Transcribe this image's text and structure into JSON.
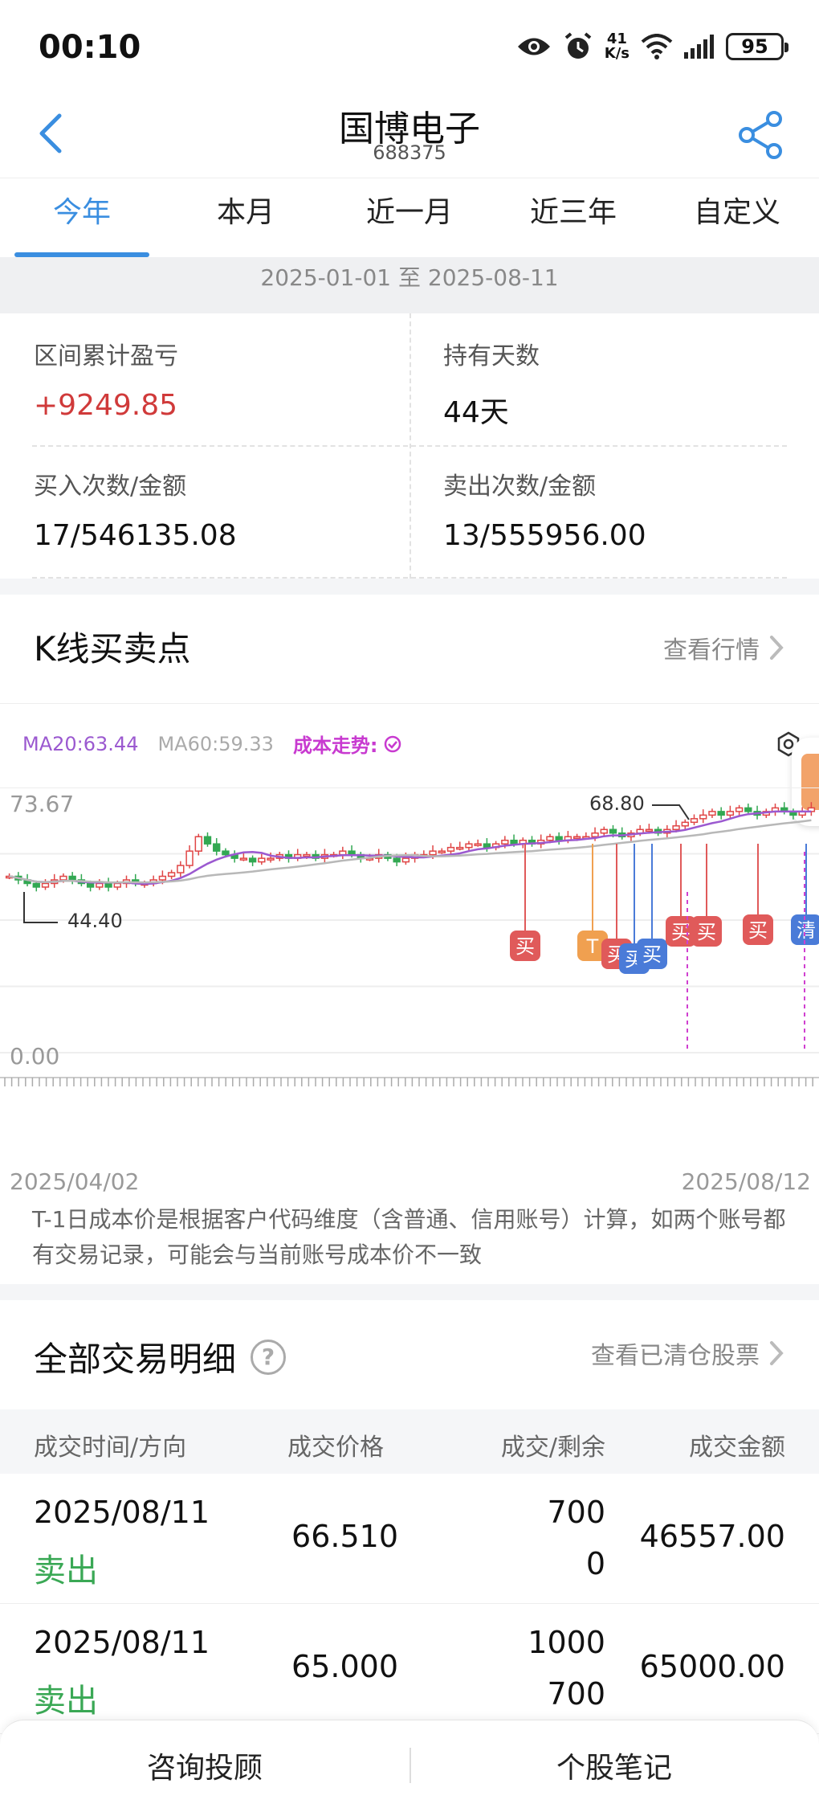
{
  "status_bar": {
    "time": "00:10",
    "net_speed_value": "41",
    "net_speed_unit": "K/s",
    "battery": "95",
    "icons": [
      "eye-icon",
      "alarm-icon",
      "wifi-icon",
      "signal-icon",
      "battery-icon"
    ]
  },
  "header": {
    "title": "国博电子",
    "code": "688375",
    "back_icon": "chevron-left-icon",
    "share_icon": "share-icon",
    "accent_color": "#3a8ee0"
  },
  "tabs": [
    {
      "label": "今年",
      "active": true
    },
    {
      "label": "本月",
      "active": false
    },
    {
      "label": "近一月",
      "active": false
    },
    {
      "label": "近三年",
      "active": false
    },
    {
      "label": "自定义",
      "active": false
    }
  ],
  "date_range": "2025-01-01 至 2025-08-11",
  "summary": {
    "pnl_label": "区间累计盈亏",
    "pnl_value": "+9249.85",
    "hold_label": "持有天数",
    "hold_value": "44天",
    "buy_label": "买入次数/金额",
    "buy_value": "17/546135.08",
    "sell_label": "卖出次数/金额",
    "sell_value": "13/555956.00"
  },
  "kline": {
    "title": "K线买卖点",
    "link": "查看行情",
    "ma20": "MA20:63.44",
    "ma60": "MA60:59.33",
    "cost_trend": "成本走势:",
    "max_label": "73.67",
    "zero_label": "0.00",
    "high_marker": "68.80",
    "low_marker": "44.40",
    "start_date": "2025/04/02",
    "end_date": "2025/08/12",
    "marker_labels": [
      "买",
      "T",
      "买",
      "买",
      "买",
      "买",
      "买",
      "买",
      "清"
    ],
    "disclaimer": "T-1日成本价是根据客户代码维度（含普通、信用账号）计算，如两个账号都有交易记录，可能会与当前账号成本价不一致"
  },
  "chart_data": {
    "type": "candlestick",
    "x_range": [
      "2025/04/02",
      "2025/08/12"
    ],
    "ylim": [
      0,
      73.67
    ],
    "y_labels": [
      "73.67",
      "0.00"
    ],
    "annotations": [
      {
        "label": "68.80",
        "kind": "period-high"
      },
      {
        "label": "44.40",
        "kind": "period-low"
      }
    ],
    "series": [
      {
        "name": "MA20",
        "latest": 63.44
      },
      {
        "name": "MA60",
        "latest": 59.33
      }
    ],
    "close_series": [
      49,
      48,
      47,
      46,
      47,
      48,
      49,
      48,
      47,
      46,
      47,
      46,
      47,
      48,
      47,
      47,
      48,
      49,
      50,
      52,
      56,
      60,
      58,
      56,
      55,
      54,
      54,
      53,
      54,
      54,
      55,
      54,
      55,
      55,
      54,
      55,
      55,
      56,
      55,
      54,
      54,
      55,
      54,
      53,
      54,
      55,
      55,
      56,
      56,
      57,
      57,
      58,
      58,
      57,
      58,
      59,
      58,
      59,
      58,
      59,
      60,
      59,
      60,
      60,
      60,
      61,
      62,
      61,
      60,
      61,
      62,
      62,
      61,
      62,
      63,
      64,
      65,
      66,
      67,
      66,
      67,
      68,
      67,
      66,
      67,
      68,
      67,
      66,
      67,
      68
    ],
    "markers": [
      {
        "label": "买",
        "color": "#e05a5a"
      },
      {
        "label": "T",
        "color": "#f0a050"
      },
      {
        "label": "买",
        "color": "#e05a5a"
      },
      {
        "label": "买",
        "color": "#4a7bd8"
      },
      {
        "label": "买",
        "color": "#4a7bd8"
      },
      {
        "label": "买",
        "color": "#e05a5a"
      },
      {
        "label": "买",
        "color": "#e05a5a"
      },
      {
        "label": "买",
        "color": "#e05a5a"
      },
      {
        "label": "清",
        "color": "#4a7bd8"
      }
    ],
    "up_color": "#e04646",
    "down_color": "#32a852"
  },
  "trades": {
    "title": "全部交易明细",
    "link": "查看已清仓股票",
    "columns": [
      "成交时间/方向",
      "成交价格",
      "成交/剩余",
      "成交金额"
    ],
    "rows": [
      {
        "date": "2025/08/11",
        "direction": "卖出",
        "price": "66.510",
        "qty": "700",
        "remaining": "0",
        "amount": "46557.00"
      },
      {
        "date": "2025/08/11",
        "direction": "卖出",
        "price": "65.000",
        "qty": "1000",
        "remaining": "700",
        "amount": "65000.00"
      }
    ]
  },
  "bottom_bar": {
    "left": "咨询投顾",
    "right": "个股笔记"
  }
}
